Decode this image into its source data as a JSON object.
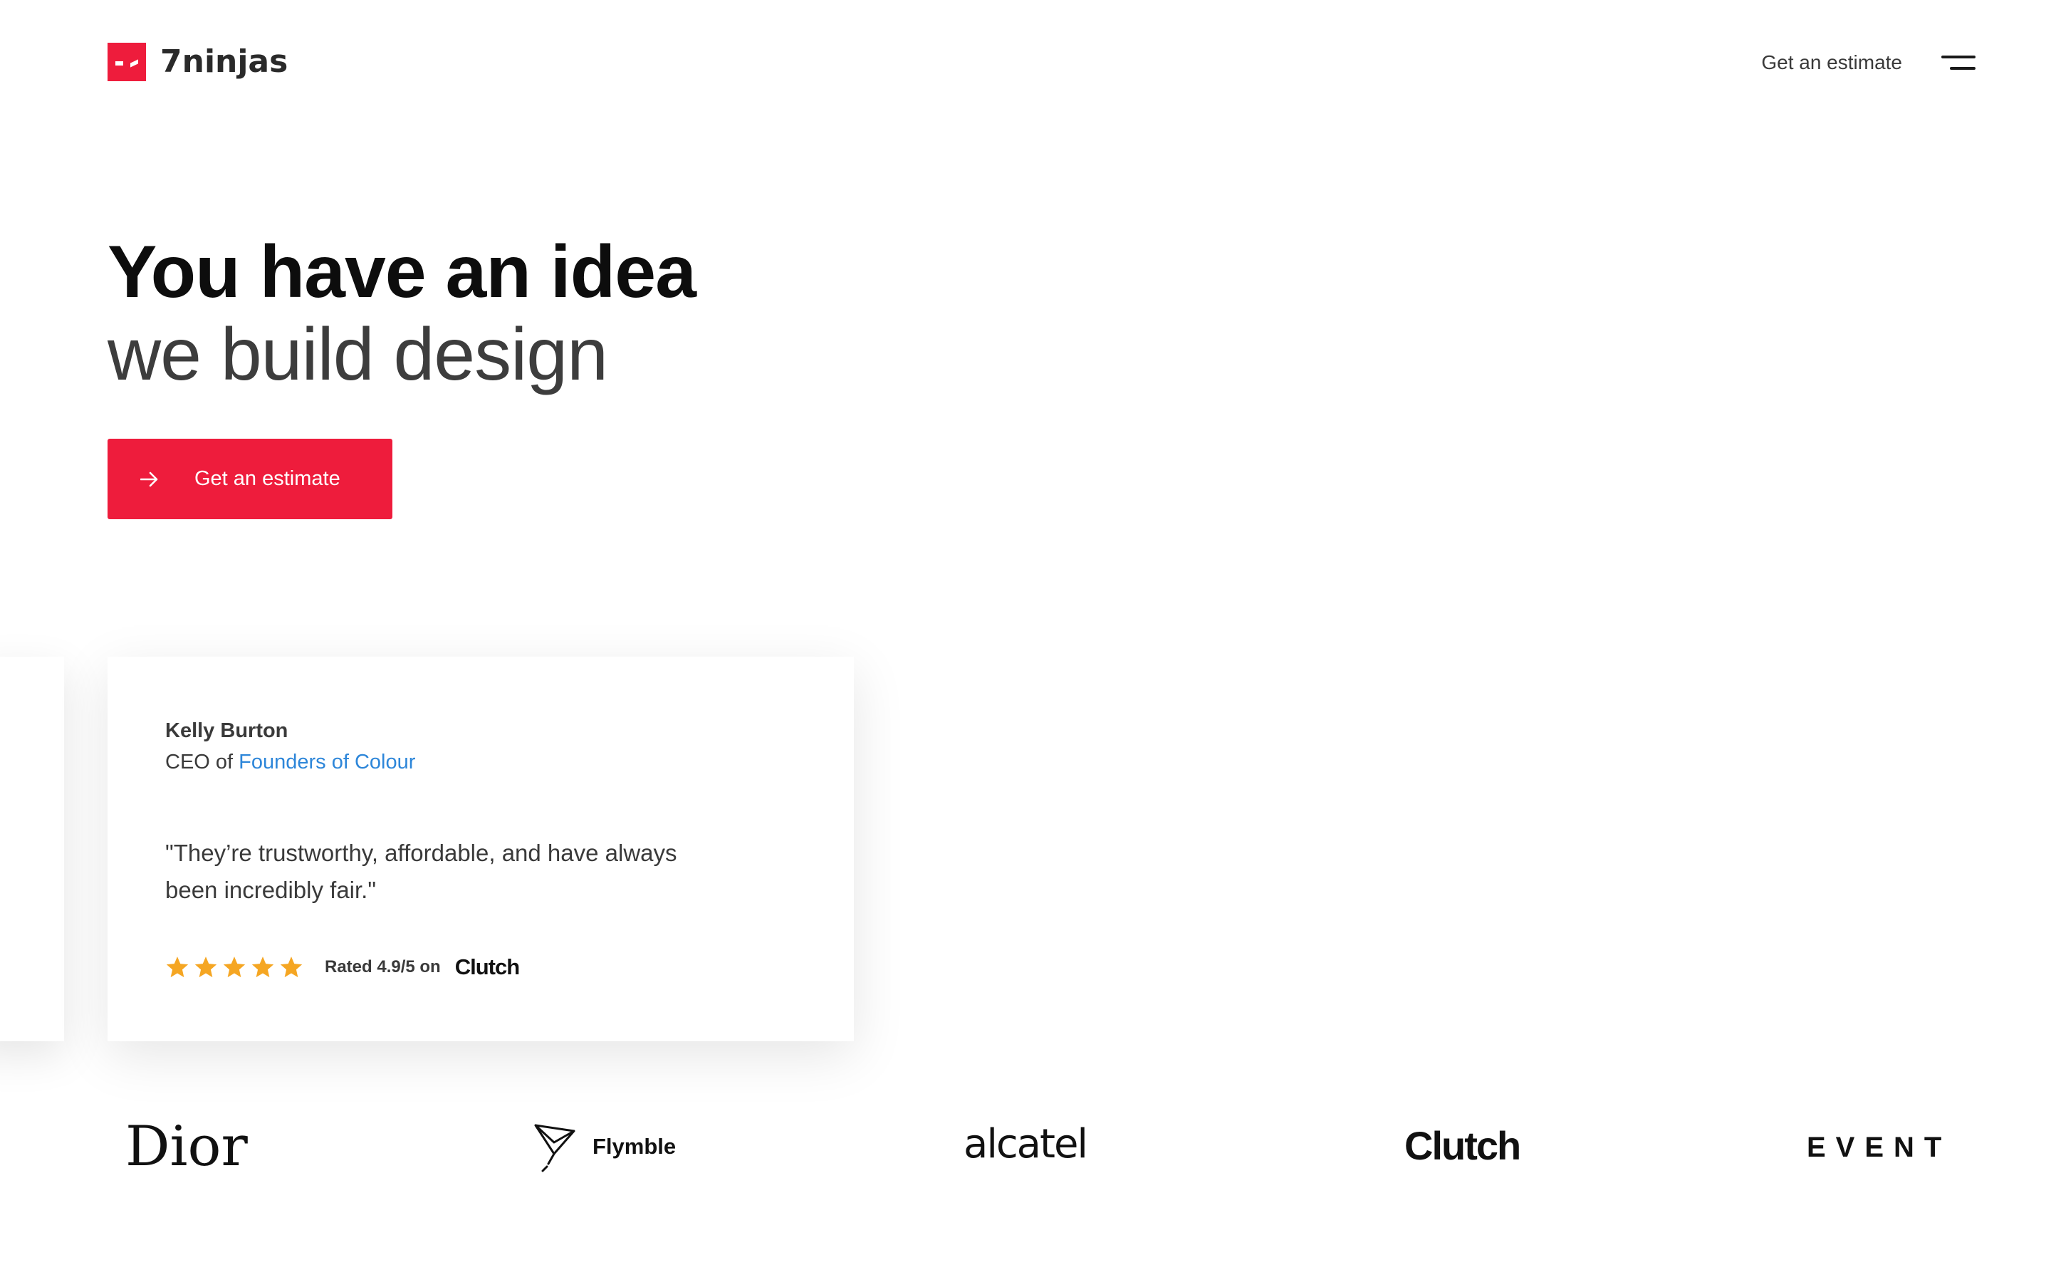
{
  "brand": {
    "name": "7ninjas",
    "accent_color": "#ee1c3c"
  },
  "header": {
    "cta_label": "Get an estimate",
    "menu_icon": "hamburger-menu-icon"
  },
  "hero": {
    "title": "You have an idea",
    "subtitle": "we build design",
    "cta_label": "Get an estimate",
    "cta_icon": "arrow-right-icon"
  },
  "testimonial": {
    "name": "Kelly Burton",
    "role_prefix": "CEO of ",
    "company": "Founders of Colour",
    "company_link_color": "#2d86d9",
    "quote": "\"They’re trustworthy, affordable, and have always been incredibly fair.\"",
    "stars": 5,
    "star_color": "#f5a623",
    "rating_text": "Rated 4.9/5 on",
    "rating_source": "Clutch"
  },
  "client_logos": [
    {
      "name": "Dior",
      "icon": "dior-logo"
    },
    {
      "name": "Flymble",
      "icon": "flymble-logo"
    },
    {
      "name": "alcatel",
      "icon": "alcatel-logo"
    },
    {
      "name": "Clutch",
      "icon": "clutch-logo"
    },
    {
      "name": "EVENT",
      "icon": "event-logo"
    }
  ]
}
